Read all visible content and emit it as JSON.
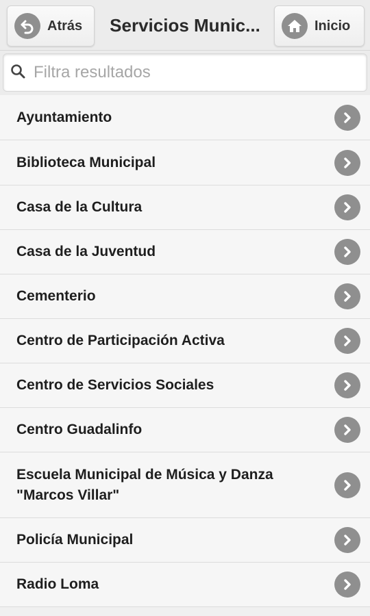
{
  "header": {
    "back_label": "Atrás",
    "title": "Servicios Munic...",
    "home_label": "Inicio"
  },
  "search": {
    "placeholder": "Filtra resultados",
    "value": ""
  },
  "list": {
    "items": [
      {
        "label": "Ayuntamiento"
      },
      {
        "label": "Biblioteca Municipal"
      },
      {
        "label": "Casa de la Cultura"
      },
      {
        "label": "Casa de la Juventud"
      },
      {
        "label": "Cementerio"
      },
      {
        "label": "Centro de Participación Activa"
      },
      {
        "label": "Centro de Servicios Sociales"
      },
      {
        "label": "Centro Guadalinfo"
      },
      {
        "label": "Escuela Municipal de Música y Danza \"Marcos Villar\""
      },
      {
        "label": "Policía Municipal"
      },
      {
        "label": "Radio Loma"
      }
    ]
  },
  "colors": {
    "icon_circle": "#8f8f8f",
    "header_bg": "#ececec",
    "list_bg": "#f6f6f6"
  },
  "icons": {
    "back": "back-arrow-icon",
    "home": "home-icon",
    "search": "search-icon",
    "row": "chevron-right-icon"
  }
}
